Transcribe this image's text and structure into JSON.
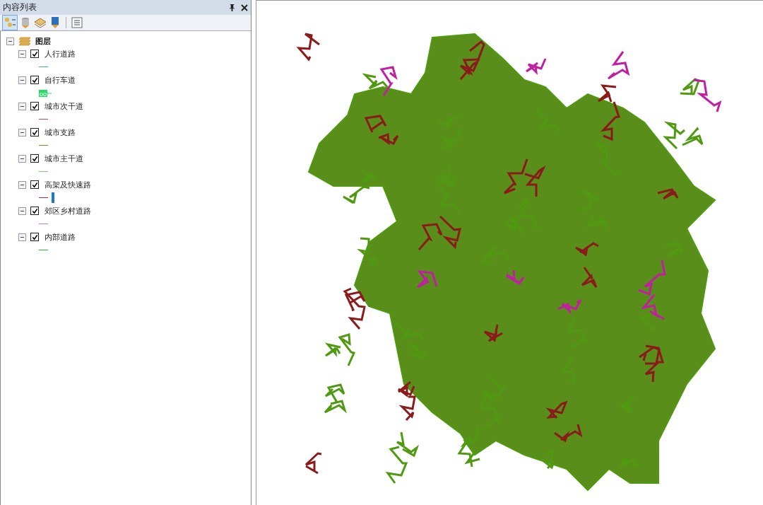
{
  "panel": {
    "title": "内容列表"
  },
  "tree": {
    "root": {
      "label": "图层",
      "expanded": true,
      "children": [
        {
          "label": "人行道路",
          "checked": true,
          "expanded": true,
          "kind": "line",
          "color": "#3cb0a0"
        },
        {
          "label": "自行车道",
          "checked": true,
          "expanded": true,
          "kind": "bike",
          "color": "#20e060"
        },
        {
          "label": "城市次干道",
          "checked": true,
          "expanded": true,
          "kind": "line",
          "color": "#c04848"
        },
        {
          "label": "城市支路",
          "checked": true,
          "expanded": true,
          "kind": "line",
          "color": "#5a9e1e"
        },
        {
          "label": "城市主干道",
          "checked": true,
          "expanded": true,
          "kind": "line",
          "color": "#80d070"
        },
        {
          "label": "高架及快速路",
          "checked": true,
          "expanded": true,
          "kind": "line-marker",
          "color": "#a0207a"
        },
        {
          "label": "郊区乡村道路",
          "checked": true,
          "expanded": true,
          "kind": "line",
          "color": "#d070c8"
        },
        {
          "label": "内部道路",
          "checked": true,
          "expanded": true,
          "kind": "line",
          "color": "#20c030"
        }
      ]
    }
  }
}
